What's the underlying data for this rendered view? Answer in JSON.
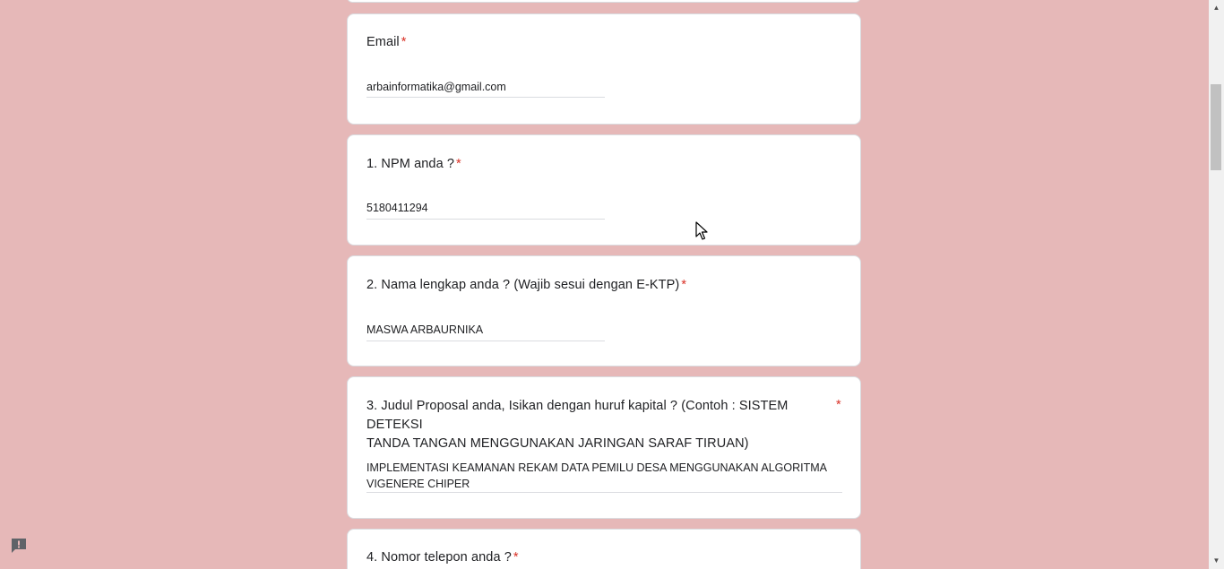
{
  "form": {
    "required_marker": "*",
    "email": {
      "label": "Email",
      "value": "arbainformatika@gmail.com"
    },
    "q1": {
      "label": "1. NPM anda ?",
      "value": "5180411294"
    },
    "q2": {
      "label": "2. Nama lengkap anda ? (Wajib sesui dengan E-KTP)",
      "value": "MASWA ARBAURNIKA"
    },
    "q3": {
      "label_line1": "3. Judul Proposal anda, Isikan dengan huruf kapital ? (Contoh : SISTEM DETEKSI",
      "label_line2": "TANDA TANGAN MENGGUNAKAN JARINGAN SARAF TIRUAN)",
      "value_line1": "IMPLEMENTASI KEAMANAN REKAM DATA PEMILU DESA MENGGUNAKAN ALGORITMA",
      "value_line2": "VIGENERE CHIPER"
    },
    "q4": {
      "label": "4. Nomor telepon anda ?"
    }
  },
  "colors": {
    "page_background": "#e6b8b8",
    "required": "#d93025"
  },
  "icons": {
    "report": "report-problem-icon",
    "cursor": "mouse-pointer-icon",
    "scroll_up": "scroll-up-arrow-icon",
    "scroll_down": "scroll-down-arrow-icon"
  }
}
